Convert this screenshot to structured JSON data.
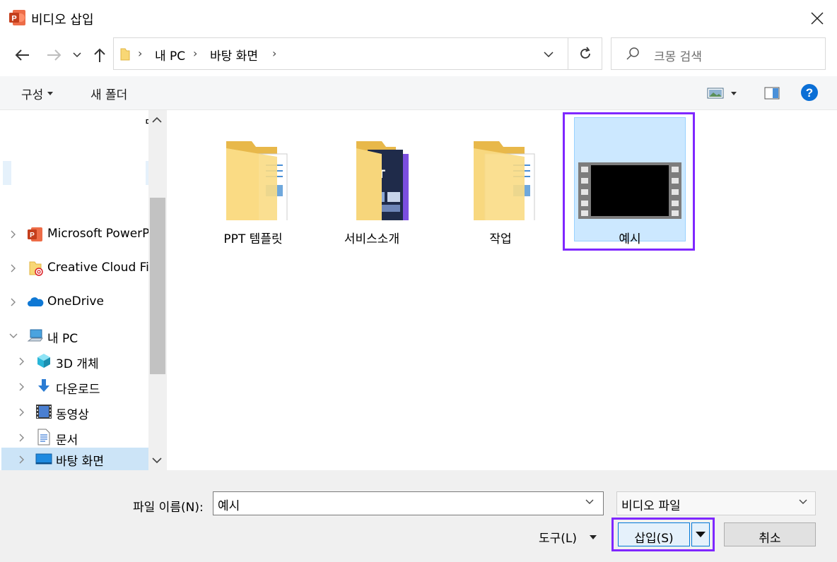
{
  "window": {
    "title": "비디오 삽입"
  },
  "address": {
    "crumbs": [
      "내 PC",
      "바탕 화면"
    ]
  },
  "search": {
    "placeholder": "크몽 검색"
  },
  "toolbar": {
    "organize_label": "구성",
    "new_folder_label": "새 폴더"
  },
  "sidebar": {
    "items": [
      {
        "label": "Microsoft PowerP",
        "icon": "powerpoint-icon"
      },
      {
        "label": "Creative Cloud Fil",
        "icon": "creative-cloud-folder-icon"
      },
      {
        "label": "OneDrive",
        "icon": "onedrive-cloud-icon"
      },
      {
        "label": "내 PC",
        "icon": "computer-icon"
      },
      {
        "label": "3D 개체",
        "icon": "3d-objects-icon"
      },
      {
        "label": "다운로드",
        "icon": "download-icon"
      },
      {
        "label": "동영상",
        "icon": "video-icon"
      },
      {
        "label": "문서",
        "icon": "document-icon"
      },
      {
        "label": "바탕 화면",
        "icon": "desktop-icon"
      }
    ]
  },
  "files": [
    {
      "label": "PPT 템플릿",
      "type": "folder"
    },
    {
      "label": "서비스소개",
      "type": "folder-with-preview"
    },
    {
      "label": "작업",
      "type": "folder"
    },
    {
      "label": "예시",
      "type": "video",
      "selected": true
    }
  ],
  "bottom": {
    "filename_label": "파일 이름(N):",
    "filename_value": "예시",
    "filetype_value": "비디오 파일",
    "tools_label": "도구(L)",
    "insert_label": "삽입(S)",
    "cancel_label": "취소"
  },
  "colors": {
    "highlight": "#7f27ff",
    "selection": "#cce8ff",
    "accent": "#0078d7"
  }
}
